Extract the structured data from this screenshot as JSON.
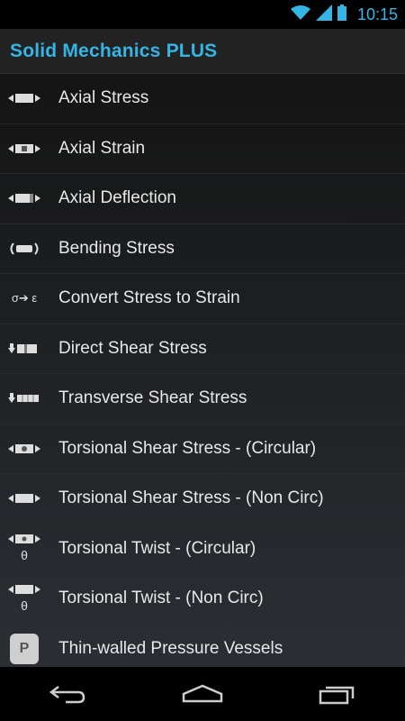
{
  "status": {
    "time": "10:15"
  },
  "app": {
    "title": "Solid Mechanics PLUS"
  },
  "icon_glyphs": {
    "convert": "σ➔ ε",
    "theta": "θ",
    "P": "P"
  },
  "menu": [
    {
      "label": "Axial Stress",
      "icon": "axial-stress-icon"
    },
    {
      "label": "Axial Strain",
      "icon": "axial-strain-icon"
    },
    {
      "label": "Axial Deflection",
      "icon": "axial-deflection-icon"
    },
    {
      "label": "Bending Stress",
      "icon": "bending-stress-icon"
    },
    {
      "label": "Convert Stress to Strain",
      "icon": "convert-stress-strain-icon"
    },
    {
      "label": "Direct Shear Stress",
      "icon": "direct-shear-icon"
    },
    {
      "label": "Transverse Shear Stress",
      "icon": "transverse-shear-icon"
    },
    {
      "label": "Torsional Shear Stress - (Circular)",
      "icon": "torsion-circular-icon"
    },
    {
      "label": "Torsional Shear Stress - (Non Circ)",
      "icon": "torsion-noncirc-icon"
    },
    {
      "label": "Torsional Twist - (Circular)",
      "icon": "twist-circular-icon"
    },
    {
      "label": "Torsional Twist - (Non Circ)",
      "icon": "twist-noncirc-icon"
    },
    {
      "label": "Thin-walled Pressure Vessels",
      "icon": "pressure-vessel-icon"
    }
  ],
  "colors": {
    "accent": "#33b5e5",
    "appbar": "#222222",
    "background": "#000000"
  }
}
